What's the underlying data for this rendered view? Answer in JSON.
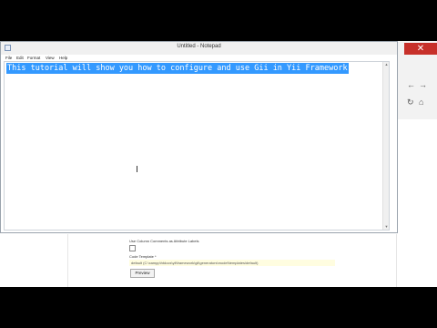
{
  "notepad": {
    "title": "Untitled - Notepad",
    "menus": [
      "File",
      "Edit",
      "Format",
      "View",
      "Help"
    ],
    "text": "This tutorial will show you how to configure and use Gii in Yii Framework"
  },
  "window_controls": {
    "close": "✕"
  },
  "browser": {
    "back_icon": "←",
    "forward_icon": "→",
    "refresh_icon": "↻",
    "home_icon": "⌂"
  },
  "form": {
    "comments_label": "Use Column Comments as Attribute Labels",
    "template_label": "Code Template *",
    "template_value": "default (C:\\xampp\\htdocs\\yii\\framework\\gii\\generators\\model\\templates\\default)",
    "preview_button": "Preview"
  }
}
